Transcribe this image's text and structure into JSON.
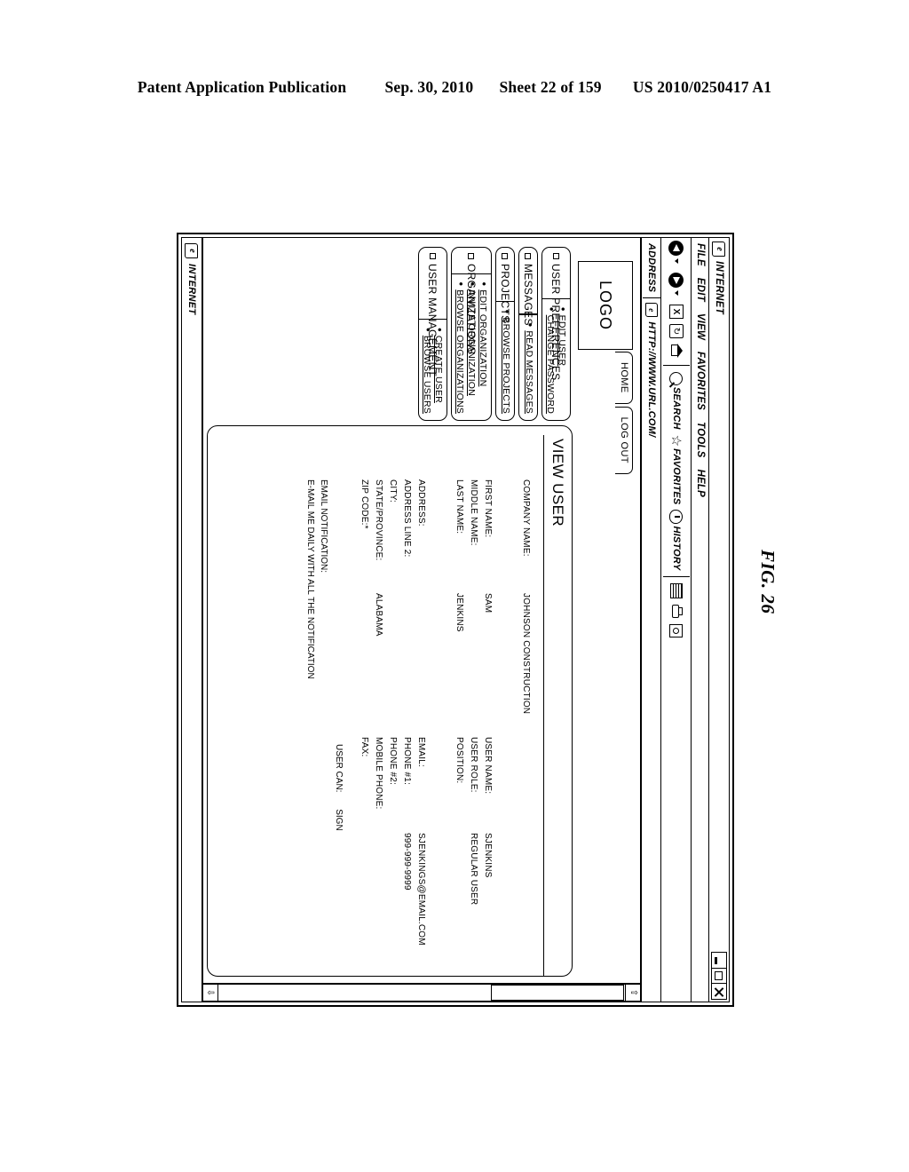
{
  "patent_header": {
    "publication": "Patent Application Publication",
    "date": "Sep. 30, 2010",
    "sheet": "Sheet 22 of 159",
    "number": "US 2010/0250417 A1"
  },
  "figure": {
    "caption": "FIG. 26"
  },
  "browser": {
    "title": "INTERNET",
    "window_buttons": {
      "minimize": "minimize",
      "maximize": "maximize",
      "close": "close"
    },
    "menu": [
      "FILE",
      "EDIT",
      "VIEW",
      "FAVORITES",
      "TOOLS",
      "HELP"
    ],
    "toolbar": {
      "back": "back",
      "forward": "forward",
      "stop": "X",
      "refresh": "refresh",
      "home": "home",
      "search_label": "SEARCH",
      "favorites_label": "FAVORITES",
      "history_label": "HISTORY",
      "mail": "mail",
      "print": "print",
      "edit": "edit"
    },
    "address": {
      "label": "ADDRESS",
      "url": "HTTP://WWW.URL.COM/"
    },
    "status": {
      "label": "INTERNET"
    }
  },
  "page": {
    "logo": "LOGO",
    "nav_tabs": [
      "HOME",
      "LOG OUT"
    ],
    "panel_title": "VIEW USER",
    "sidebar": [
      {
        "title": "USER PREFERENCES",
        "links": [
          "EDIT USER",
          "CHANGE PASSWORD"
        ]
      },
      {
        "title": "MESSAGES",
        "links": [
          "READ MESSAGES"
        ]
      },
      {
        "title": "PROJECTS",
        "links": [
          "BROWSE PROJECTS"
        ]
      },
      {
        "title": "ORGANIZATIONS",
        "links": [
          "EDIT ORGANIZATION",
          "INVITE ORGANIZATION",
          "BROWSE ORGANIZATIONS"
        ]
      },
      {
        "title": "USER MANAGEMENT",
        "links": [
          "CREATE USER",
          "BROWSE USERS"
        ]
      }
    ],
    "form": {
      "company_name_label": "COMPANY NAME:",
      "company_name_value": "JOHNSON CONSTRUCTION",
      "first_name_label": "FIRST NAME:",
      "first_name_value": "SAM",
      "middle_name_label": "MIDDLE NAME:",
      "middle_name_value": "",
      "last_name_label": "LAST NAME:",
      "last_name_value": "JENKINS",
      "address_label": "ADDRESS:",
      "address_value": "",
      "address2_label": "ADDRESS LINE 2:",
      "address2_value": "",
      "city_label": "CITY:",
      "city_value": "",
      "state_label": "STATE/PROVINCE:",
      "state_value": "ALABAMA",
      "zip_label": "ZIP CODE:*",
      "zip_value": "",
      "user_name_label": "USER NAME:",
      "user_name_value": "SJENKINS",
      "user_role_label": "USER ROLE:",
      "user_role_value": "REGULAR USER",
      "position_label": "POSITION:",
      "position_value": "",
      "email_label": "EMAIL:",
      "email_value": "SJENKINGS@EMAIL.COM",
      "phone1_label": "PHONE #1:",
      "phone1_value": "999-999-9999",
      "phone2_label": "PHONE #2:",
      "phone2_value": "",
      "mobile_label": "MOBILE PHONE:",
      "mobile_value": "",
      "fax_label": "FAX:",
      "fax_value": "",
      "email_notification_label": "EMAIL NOTIFICATION:",
      "email_notification_text": "E-MAIL ME DAILY WITH ALL THE NOTIFICATION",
      "user_can_label": "USER CAN:",
      "user_can_value": "SIGN"
    }
  }
}
